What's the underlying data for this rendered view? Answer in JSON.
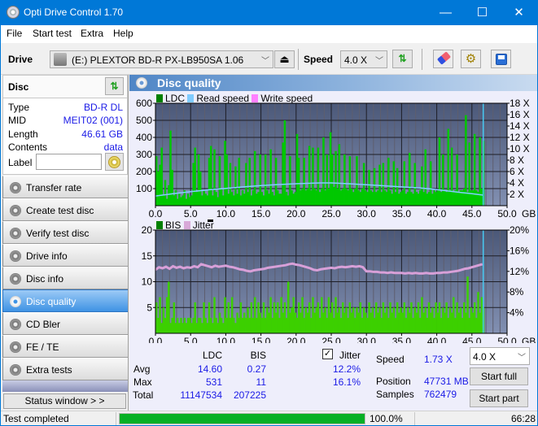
{
  "window": {
    "title": "Opti Drive Control 1.70",
    "minimize_glyph": "—",
    "maximize_glyph": "☐",
    "close_glyph": "✕"
  },
  "menu": {
    "items": [
      {
        "label": "File"
      },
      {
        "label": "Start test"
      },
      {
        "label": "Extra"
      },
      {
        "label": "Help"
      }
    ]
  },
  "toolbar": {
    "drive_label": "Drive",
    "drive_value": "(E:)  PLEXTOR BD-R  PX-LB950SA 1.06",
    "speed_label": "Speed",
    "speed_value": "4.0 X",
    "icons": [
      "drive-icon",
      "eject-icon",
      "refresh-icon",
      "eraser-icon",
      "settings-icon",
      "save-icon"
    ]
  },
  "disc": {
    "heading": "Disc",
    "rows": [
      {
        "label": "Type",
        "value": "BD-R DL"
      },
      {
        "label": "MID",
        "value": "MEIT02 (001)"
      },
      {
        "label": "Length",
        "value": "46.61 GB"
      },
      {
        "label": "Contents",
        "value": "data"
      }
    ],
    "label_field": {
      "label": "Label",
      "value": ""
    }
  },
  "nav": {
    "items": [
      {
        "label": "Transfer rate"
      },
      {
        "label": "Create test disc"
      },
      {
        "label": "Verify test disc"
      },
      {
        "label": "Drive info"
      },
      {
        "label": "Disc info"
      },
      {
        "label": "Disc quality"
      },
      {
        "label": "CD Bler"
      },
      {
        "label": "FE / TE"
      },
      {
        "label": "Extra tests"
      }
    ],
    "selected": "Disc quality",
    "status_window": "Status window > >"
  },
  "panel": {
    "title": "Disc quality",
    "top_legend": [
      {
        "label": "LDC",
        "color": "#008000"
      },
      {
        "label": "Read speed",
        "color": "#80ccff"
      },
      {
        "label": "Write speed",
        "color": "#ff80ff"
      }
    ],
    "bottom_legend": [
      {
        "label": "BIS",
        "color": "#008000"
      },
      {
        "label": "Jitter",
        "color": "#d8a8d8"
      }
    ]
  },
  "stats": {
    "col_ldc": "LDC",
    "col_bis": "BIS",
    "rows": [
      {
        "label": "Avg",
        "ldc": "14.60",
        "bis": "0.27",
        "jitter": "12.2%"
      },
      {
        "label": "Max",
        "ldc": "531",
        "bis": "11",
        "jitter": "16.1%"
      },
      {
        "label": "Total",
        "ldc": "11147534",
        "bis": "207225"
      }
    ],
    "jitter_label": "Jitter",
    "jitter_checked": true,
    "speed_label": "Speed",
    "speed_value": "1.73 X",
    "position_label": "Position",
    "position_value": "47731 MB",
    "samples_label": "Samples",
    "samples_value": "762479",
    "speed_select": "4.0 X",
    "start_full": "Start full",
    "start_part": "Start part"
  },
  "status": {
    "text": "Test completed",
    "progress": 100.0,
    "progress_text": "100.0%",
    "elapsed": "66:28",
    "progress_color": "#06b025"
  },
  "chart_data": [
    {
      "type": "bar",
      "title": "LDC / Read speed",
      "legend": [
        "LDC",
        "Read speed",
        "Write speed"
      ],
      "legend_position": "top-left",
      "xlabel": "GB",
      "xlim": [
        0,
        50
      ],
      "ylim": [
        0,
        600
      ],
      "y2lim": [
        0,
        18
      ],
      "xticks": [
        "0.0",
        "5.0",
        "10.0",
        "15.0",
        "20.0",
        "25.0",
        "30.0",
        "35.0",
        "40.0",
        "45.0",
        "50.0"
      ],
      "yticks": [
        "100",
        "200",
        "300",
        "400",
        "500",
        "600"
      ],
      "y2ticks": [
        "2 X",
        "4 X",
        "6 X",
        "8 X",
        "10 X",
        "12 X",
        "14 X",
        "16 X",
        "18 X"
      ],
      "grid": true,
      "x_start": 0,
      "x_step": 0.25,
      "position_marker": 46.61,
      "series": [
        {
          "name": "LDC",
          "color": "#00c800",
          "values": [
            290,
            200,
            240,
            340,
            60,
            150,
            40,
            120,
            440,
            210,
            60,
            90,
            40,
            70,
            50,
            60,
            90,
            40,
            70,
            50,
            60,
            250,
            340,
            80,
            300,
            200,
            60,
            90,
            70,
            60,
            280,
            350,
            60,
            330,
            80,
            50,
            290,
            100,
            60,
            380,
            300,
            70,
            250,
            80,
            60,
            230,
            70,
            280,
            60,
            90,
            70,
            250,
            80,
            280,
            60,
            90,
            320,
            70,
            80,
            300,
            80,
            60,
            300,
            90,
            70,
            330,
            80,
            60,
            280,
            90,
            70,
            70,
            370,
            500,
            80,
            60,
            290,
            90,
            70,
            80,
            420,
            280,
            90,
            100,
            280,
            90,
            100,
            350,
            90,
            340,
            100,
            90,
            340,
            80,
            100,
            400,
            90,
            300,
            100,
            430,
            300,
            110,
            320,
            100,
            360,
            90,
            100,
            300,
            100,
            90,
            290,
            100,
            80,
            100,
            290,
            90,
            80,
            100,
            250,
            90,
            80,
            210,
            90,
            80,
            220,
            80,
            90,
            240,
            80,
            250,
            90,
            80,
            280,
            90,
            70,
            260,
            80,
            220,
            70,
            80,
            90,
            260,
            70,
            80,
            310,
            80,
            70,
            250,
            80,
            70,
            90,
            230,
            80,
            330,
            70,
            80,
            260,
            70,
            90,
            80,
            90,
            400,
            80,
            300,
            90,
            80,
            450,
            90,
            340,
            80,
            90,
            300,
            80,
            90,
            90,
            100,
            530,
            80,
            370,
            90,
            90,
            420,
            90,
            80,
            400,
            100,
            380
          ]
        },
        {
          "name": "Read speed",
          "color": "#80d0ff",
          "unit": "X",
          "points": [
            [
              0,
              1.7
            ],
            [
              2.5,
              2.1
            ],
            [
              5,
              2.47
            ],
            [
              7.5,
              2.78
            ],
            [
              10,
              3.04
            ],
            [
              12.5,
              3.3
            ],
            [
              15,
              3.53
            ],
            [
              17.5,
              3.72
            ],
            [
              20,
              3.86
            ],
            [
              23.5,
              4.0
            ],
            [
              25,
              4.0
            ],
            [
              27.5,
              3.85
            ],
            [
              30,
              3.67
            ],
            [
              32.5,
              3.5
            ],
            [
              35,
              3.3
            ],
            [
              37.5,
              3.12
            ],
            [
              39,
              2.96
            ],
            [
              41.7,
              2.57
            ],
            [
              43.5,
              2.3
            ],
            [
              45,
              2.1
            ],
            [
              46.61,
              1.86
            ]
          ]
        },
        {
          "name": "Write speed",
          "color": "#ff80ff",
          "points": []
        }
      ]
    },
    {
      "type": "bar",
      "title": "BIS / Jitter",
      "legend": [
        "BIS",
        "Jitter"
      ],
      "legend_position": "top-left",
      "xlabel": "GB",
      "xlim": [
        0,
        50
      ],
      "ylim": [
        0,
        20
      ],
      "y2lim": [
        0,
        20
      ],
      "xticks": [
        "0.0",
        "5.0",
        "10.0",
        "15.0",
        "20.0",
        "25.0",
        "30.0",
        "35.0",
        "40.0",
        "45.0",
        "50.0"
      ],
      "yticks": [
        "5",
        "10",
        "15",
        "20"
      ],
      "y2ticks": [
        "4%",
        "8%",
        "12%",
        "16%",
        "20%"
      ],
      "grid": true,
      "x_start": 0,
      "x_step": 0.25,
      "position_marker": 46.61,
      "series": [
        {
          "name": "BIS",
          "color": "#3cd000",
          "values": [
            6,
            3,
            7,
            2,
            5,
            3,
            7,
            10,
            2,
            3,
            6,
            2,
            3,
            2,
            3,
            2,
            3,
            2,
            3,
            3,
            2,
            3,
            6,
            2,
            3,
            3,
            2,
            6,
            3,
            2,
            6,
            3,
            2,
            7,
            3,
            2,
            4,
            3,
            2,
            7,
            3,
            6,
            3,
            7,
            3,
            2,
            4,
            3,
            6,
            3,
            4,
            3,
            5,
            3,
            6,
            3,
            7,
            3,
            6,
            4,
            3,
            6,
            3,
            5,
            4,
            7,
            3,
            6,
            4,
            6,
            3,
            7,
            4,
            6,
            3,
            10,
            4,
            5,
            7,
            4,
            3,
            6,
            4,
            7,
            3,
            5,
            4,
            6,
            3,
            7,
            4,
            5,
            6,
            3,
            7,
            4,
            5,
            3,
            7,
            4,
            6,
            3,
            7,
            4,
            5,
            3,
            6,
            4,
            5,
            3,
            6,
            4,
            5,
            3,
            5,
            4,
            6,
            3,
            5,
            4,
            3,
            6,
            4,
            5,
            3,
            6,
            4,
            5,
            3,
            6,
            4,
            5,
            3,
            6,
            4,
            5,
            3,
            6,
            4,
            5,
            4,
            6,
            3,
            5,
            4,
            6,
            3,
            5,
            4,
            6,
            3,
            7,
            4,
            5,
            3,
            6,
            4,
            5,
            3,
            6,
            4,
            6,
            3,
            5,
            4,
            6,
            3,
            5,
            4,
            7,
            3,
            6,
            4,
            5,
            3,
            6,
            4,
            11,
            3,
            5,
            4,
            6,
            3,
            8,
            4,
            7,
            5
          ]
        },
        {
          "name": "Jitter",
          "color": "#d8a0d8",
          "unit": "%",
          "x_step": 0.5,
          "values": [
            12.3,
            12.8,
            12.6,
            12.9,
            12.5,
            13.0,
            12.7,
            12.9,
            12.6,
            12.8,
            12.7,
            13.0,
            12.8,
            13.4,
            13.2,
            13.0,
            12.8,
            13.1,
            12.9,
            13.0,
            13.1,
            12.9,
            12.8,
            12.6,
            12.4,
            12.3,
            12.1,
            12.0,
            12.2,
            12.3,
            12.4,
            12.5,
            12.7,
            12.8,
            12.9,
            13.0,
            13.1,
            13.2,
            13.4,
            13.5,
            13.3,
            13.2,
            13.0,
            12.8,
            12.6,
            12.3,
            12.2,
            12.4,
            12.5,
            12.6,
            12.7,
            12.6,
            12.8,
            12.9,
            12.8,
            12.9,
            13.0,
            12.9,
            13.0,
            12.8,
            12.0,
            12.0,
            11.9,
            11.9,
            11.8,
            11.8,
            11.7,
            11.8,
            11.7,
            11.7,
            11.7,
            11.6,
            11.7,
            11.6,
            11.7,
            11.6,
            11.6,
            11.7,
            11.6,
            11.6,
            11.7,
            11.7,
            11.8,
            11.8,
            11.9,
            12.0,
            12.1,
            12.3,
            12.5,
            12.6,
            12.8,
            13.0,
            13.2,
            13.4
          ]
        }
      ]
    }
  ]
}
